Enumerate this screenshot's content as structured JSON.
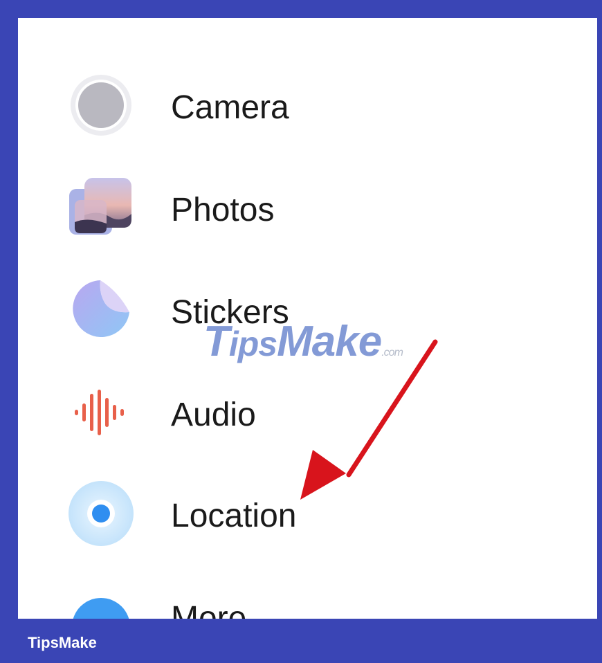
{
  "menu": {
    "items": [
      {
        "label": "Camera",
        "icon": "camera-icon"
      },
      {
        "label": "Photos",
        "icon": "photos-icon"
      },
      {
        "label": "Stickers",
        "icon": "stickers-icon"
      },
      {
        "label": "Audio",
        "icon": "audio-waveform-icon"
      },
      {
        "label": "Location",
        "icon": "location-icon"
      },
      {
        "label": "More",
        "icon": "chevron-down-icon"
      }
    ]
  },
  "watermark": {
    "brand_part1": "T",
    "brand_part2": "ips",
    "brand_part3": "Make",
    "tld": ".com"
  },
  "footer": {
    "brand": "TipsMake"
  },
  "colors": {
    "frame": "#3a45b5",
    "arrow": "#d8141c",
    "audio_icon": "#e8604a",
    "location_icon": "#2f8ef0",
    "more_icon": "#3f9cf2"
  }
}
